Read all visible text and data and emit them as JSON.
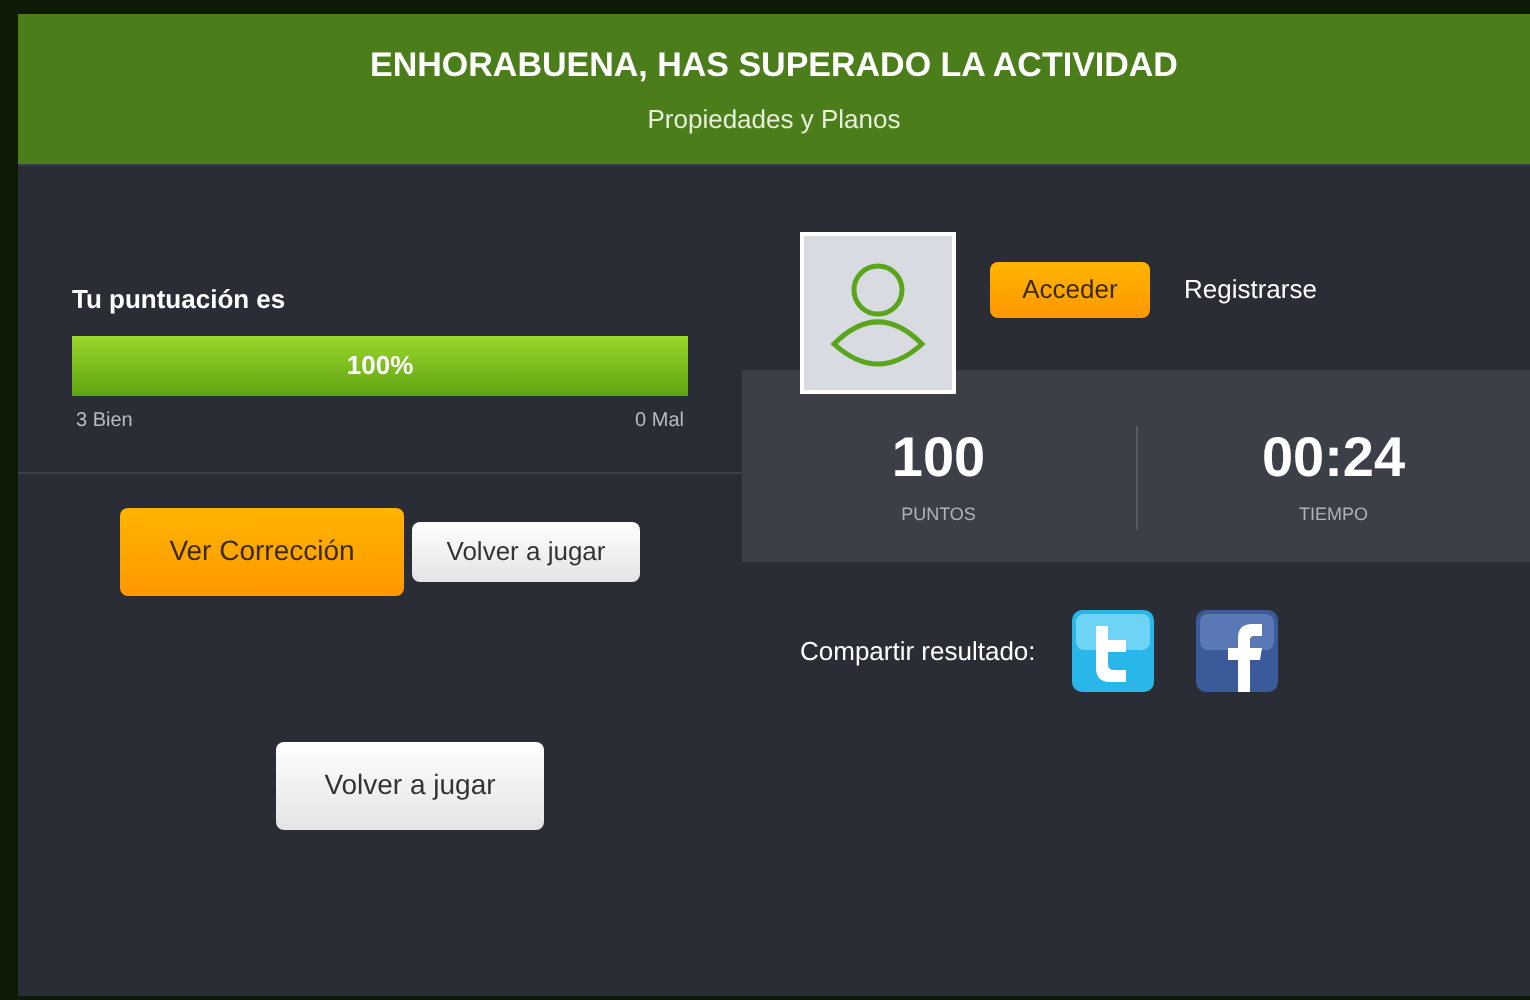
{
  "header": {
    "title": "ENHORABUENA, HAS SUPERADO LA ACTIVIDAD",
    "subtitle": "Propiedades y Planos"
  },
  "score": {
    "label": "Tu puntuación es",
    "level": 1,
    "reading": "100%",
    "correct": "3 Bien",
    "wrong": "0 Mal"
  },
  "actions": [
    "Ver Corrección",
    "Volver a jugar"
  ],
  "replay_button": "Volver a jugar",
  "account": {
    "login": "Acceder",
    "register": "Registrarse"
  },
  "stats": [
    {
      "value": "100",
      "label": "PUNTOS"
    },
    {
      "value": "00:24",
      "label": "TIEMPO"
    }
  ],
  "share": {
    "label": "Compartir resultado:"
  }
}
